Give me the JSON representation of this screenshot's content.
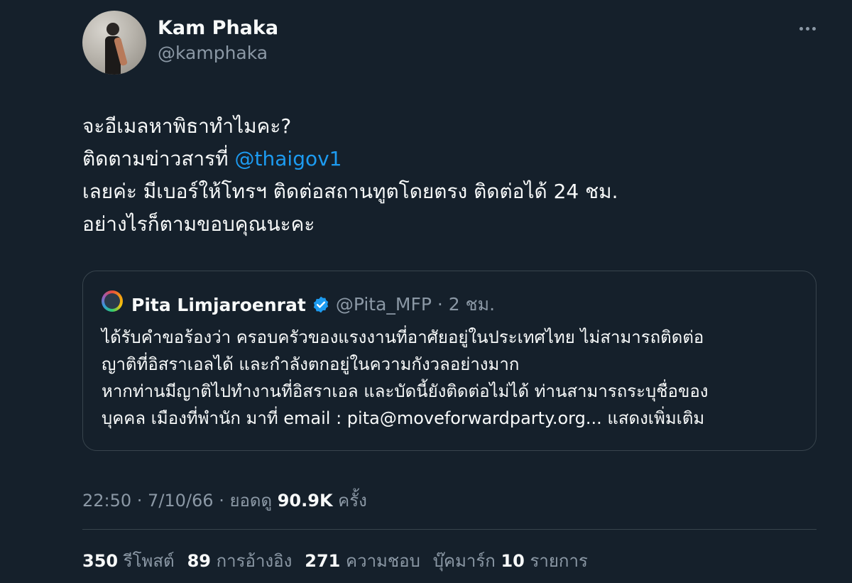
{
  "author": {
    "name": "Kam Phaka",
    "handle": "@kamphaka"
  },
  "tweet": {
    "line1": "จะอีเมลหาพิธาทำไมคะ?",
    "line2_text": "ติดตามข่าวสารที่ ",
    "line2_mention": "@thaigov1",
    "line3": "เลยค่ะ มีเบอร์ให้โทรฯ ติดต่อสถานทูตโดยตรง ติดต่อได้ 24 ชม.",
    "line4": "อย่างไรก็ตามขอบคุณนะคะ"
  },
  "quote": {
    "name": "Pita Limjaroenrat",
    "meta": "@Pita_MFP · 2 ชม.",
    "lines": [
      "ได้รับคำขอร้องว่า ครอบครัวของแรงงานที่อาศัยอยู่ในประเทศไทย ไม่สามารถติดต่อ",
      "ญาติที่อิสราเอลได้ และกำลังตกอยู่ในความกังวลอย่างมาก",
      "หากท่านมีญาติไปทำงานที่อิสราเอล และบัดนี้ยังติดต่อไม่ได้ ท่านสามารถระบุชื่อของ",
      "บุคคล เมืองที่พำนัก มาที่ email : pita@moveforwardparty.org... แสดงเพิ่มเติม"
    ]
  },
  "meta": {
    "time_date": "22:50 · 7/10/66 · ยอดดู ",
    "views": "90.9K",
    "views_suffix": " ครั้ง"
  },
  "stats": {
    "reposts_count": "350",
    "reposts_label": "รีโพสต์",
    "quotes_count": "89",
    "quotes_label": "การอ้างอิง",
    "likes_count": "271",
    "likes_label": "ความชอบ",
    "bookmarks_label": "บุ๊คมาร์ก",
    "bookmarks_count": "10",
    "bookmarks_suffix": "รายการ"
  },
  "colors": {
    "background": "#15202b",
    "accent": "#1d9bf0",
    "secondary_text": "#8b98a5",
    "border": "#38444d"
  },
  "icons": {
    "more": "more-horizontal-icon",
    "verified": "verified-badge-icon"
  }
}
